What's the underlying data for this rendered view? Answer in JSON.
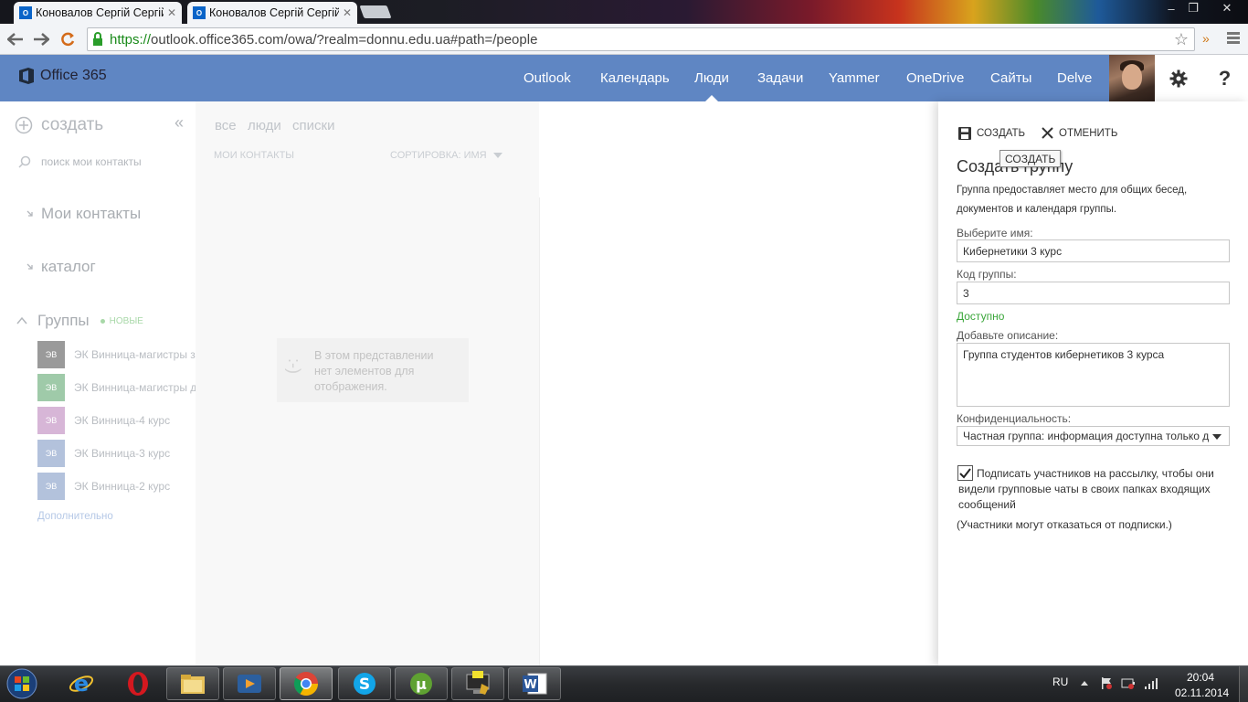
{
  "browser": {
    "tabs": [
      {
        "title": "Коновалов Сергій Сергій",
        "favicon": "outlook-favicon"
      },
      {
        "title": "Коновалов Сергій Сергій",
        "favicon": "outlook-favicon"
      }
    ],
    "url_scheme": "https://",
    "url_host": "outlook.office365.com",
    "url_rest": "/owa/?realm=donnu.edu.ua#path=/people",
    "window_controls": [
      "–",
      "❐",
      "✕"
    ]
  },
  "o365": {
    "logo_text": "Office 365",
    "nav": [
      "Outlook",
      "Календарь",
      "Люди",
      "Задачи",
      "Yammer",
      "OneDrive",
      "Сайты",
      "Delve"
    ],
    "active_nav": "Люди",
    "help_label": "?"
  },
  "left": {
    "create_label": "создать",
    "collapse_label": "«",
    "search_placeholder": "поиск мои контакты",
    "my_contacts": "Мои контакты",
    "catalog": "каталог",
    "groups": "Группы",
    "groups_badge": "НОВЫЕ",
    "group_items": [
      {
        "initials": "ЭВ",
        "name": "ЭК Винница-магистры з",
        "color": "#9a9a9a"
      },
      {
        "initials": "ЭВ",
        "name": "ЭК Винница-магистры д",
        "color": "#7fb88e"
      },
      {
        "initials": "ЭВ",
        "name": "ЭК Винница-4 курс",
        "color": "#c6a0c6"
      },
      {
        "initials": "ЭВ",
        "name": "ЭК Винница-3 курс",
        "color": "#93a9cc"
      },
      {
        "initials": "ЭВ",
        "name": "ЭК Винница-2 курс",
        "color": "#93a9cc"
      }
    ],
    "more_link": "Дополнительно"
  },
  "middle": {
    "filters": [
      "все",
      "люди",
      "списки"
    ],
    "list_title": "МОИ КОНТАКТЫ",
    "sort_label": "СОРТИРОВКА: ИМЯ",
    "empty_face": ":-)",
    "empty_text": "В этом представлении нет элементов для отображения."
  },
  "flyout": {
    "create_label": "СОЗДАТЬ",
    "cancel_label": "ОТМЕНИТЬ",
    "tooltip": "СОЗДАТЬ",
    "heading": "Создать группу",
    "description": "Группа предоставляет место для общих бесед, документов и календаря группы.",
    "name_label": "Выберите имя:",
    "name_value": "Кибернетики 3 курс",
    "code_label": "Код группы:",
    "code_value": "3",
    "available": "Доступно",
    "desc_label": "Добавьте описание:",
    "desc_value": "Группа студентов кибернетиков 3 курса",
    "privacy_label": "Конфиденциальность:",
    "privacy_value": "Частная группа: информация доступна только дл",
    "subscribe_checked": true,
    "subscribe_text": "Подписать участников на рассылку, чтобы они видели групповые чаты в своих папках входящих сообщений",
    "unsubscribe_note": "(Участники могут отказаться от подписки.)"
  },
  "taskbar": {
    "lang": "RU",
    "time": "20:04",
    "date": "02.11.2014"
  }
}
